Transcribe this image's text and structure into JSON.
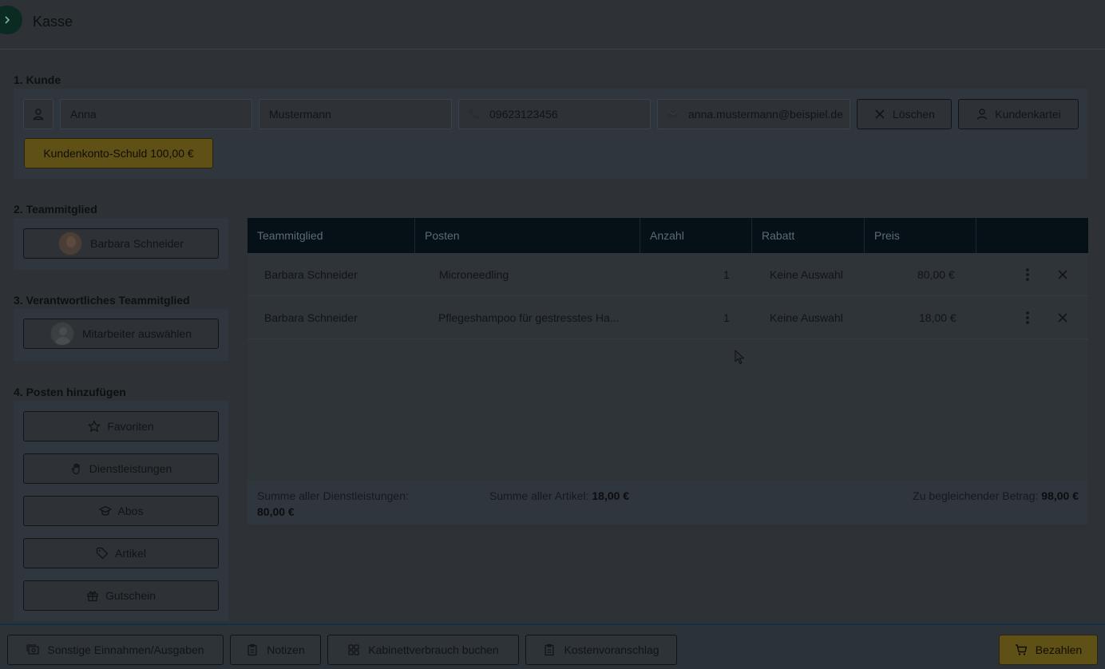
{
  "header": {
    "title": "Kasse",
    "toggle_icon": "chevron-right-icon"
  },
  "customer": {
    "section_label": "1. Kunde",
    "first_name": "Anna",
    "last_name": "Mustermann",
    "phone": "09623123456",
    "email": "anna.mustermann@beispiel.de",
    "delete_label": "Löschen",
    "record_label": "Kundenkartei",
    "debt_label": "Kundenkonto-Schuld 100,00 €"
  },
  "team_member": {
    "section_label": "2. Teammitglied",
    "selected": "Barbara Schneider"
  },
  "responsible": {
    "section_label": "3. Verantwortliches Teammitglied",
    "placeholder": "Mitarbeiter auswählen"
  },
  "add_items": {
    "section_label": "4. Posten hinzufügen",
    "buttons": [
      {
        "label": "Favoriten",
        "icon": "star-icon"
      },
      {
        "label": "Dienstleistungen",
        "icon": "hand-icon"
      },
      {
        "label": "Abos",
        "icon": "graduation-cap-icon"
      },
      {
        "label": "Artikel",
        "icon": "tag-icon"
      },
      {
        "label": "Gutschein",
        "icon": "gift-icon"
      }
    ]
  },
  "table": {
    "columns": [
      "Teammitglied",
      "Posten",
      "Anzahl",
      "Rabatt",
      "Preis"
    ],
    "rows": [
      {
        "member": "Barbara Schneider",
        "item": "Microneedling",
        "qty": "1",
        "discount": "Keine Auswahl",
        "price": "80,00 €"
      },
      {
        "member": "Barbara Schneider",
        "item": "Pflegeshampoo für gestresstes Ha...",
        "qty": "1",
        "discount": "Keine Auswahl",
        "price": "18,00 €"
      }
    ],
    "summary": {
      "services_label": "Summe aller Dienstleistungen:",
      "services_value": "80,00 €",
      "articles_label": "Summe aller Artikel:",
      "articles_value": "18,00 €",
      "total_label": "Zu begleichender Betrag:",
      "total_value": "98,00 €"
    }
  },
  "footer": {
    "other_label": "Sonstige Einnahmen/Ausgaben",
    "notes_label": "Notizen",
    "cabin_label": "Kabinettverbrauch buchen",
    "estimate_label": "Kostenvoranschlag",
    "pay_label": "Bezahlen"
  }
}
